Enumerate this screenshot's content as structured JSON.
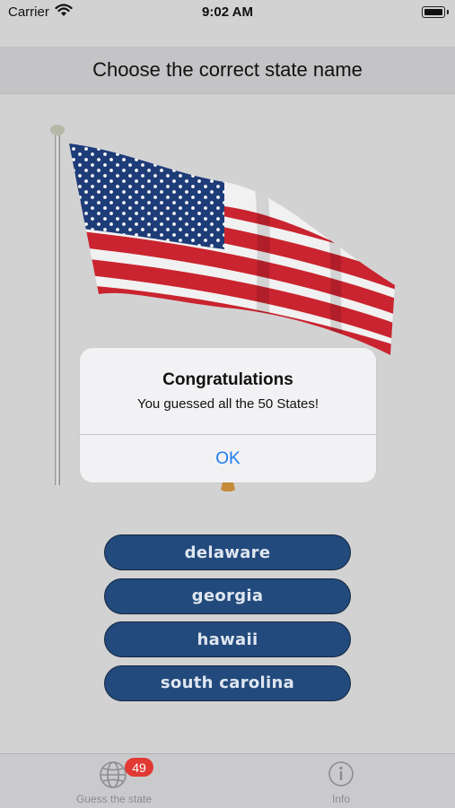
{
  "status_bar": {
    "carrier": "Carrier",
    "time": "9:02 AM"
  },
  "header": {
    "title": "Choose the correct state name"
  },
  "alert": {
    "title": "Congratulations",
    "message": "You guessed all the 50 States!",
    "ok_label": "OK",
    "ok_color": "#1e7cf2"
  },
  "answers": [
    {
      "label": "delaware"
    },
    {
      "label": "georgia"
    },
    {
      "label": "hawaii"
    },
    {
      "label": "south carolina"
    }
  ],
  "tab_bar": {
    "tabs": [
      {
        "label": "Guess the state",
        "icon": "globe-icon",
        "badge": "49"
      },
      {
        "label": "Info",
        "icon": "info-icon"
      }
    ]
  },
  "colors": {
    "button_fill": "#234a7c",
    "badge": "#e13a33",
    "header_bg": "#c4c4c7"
  }
}
